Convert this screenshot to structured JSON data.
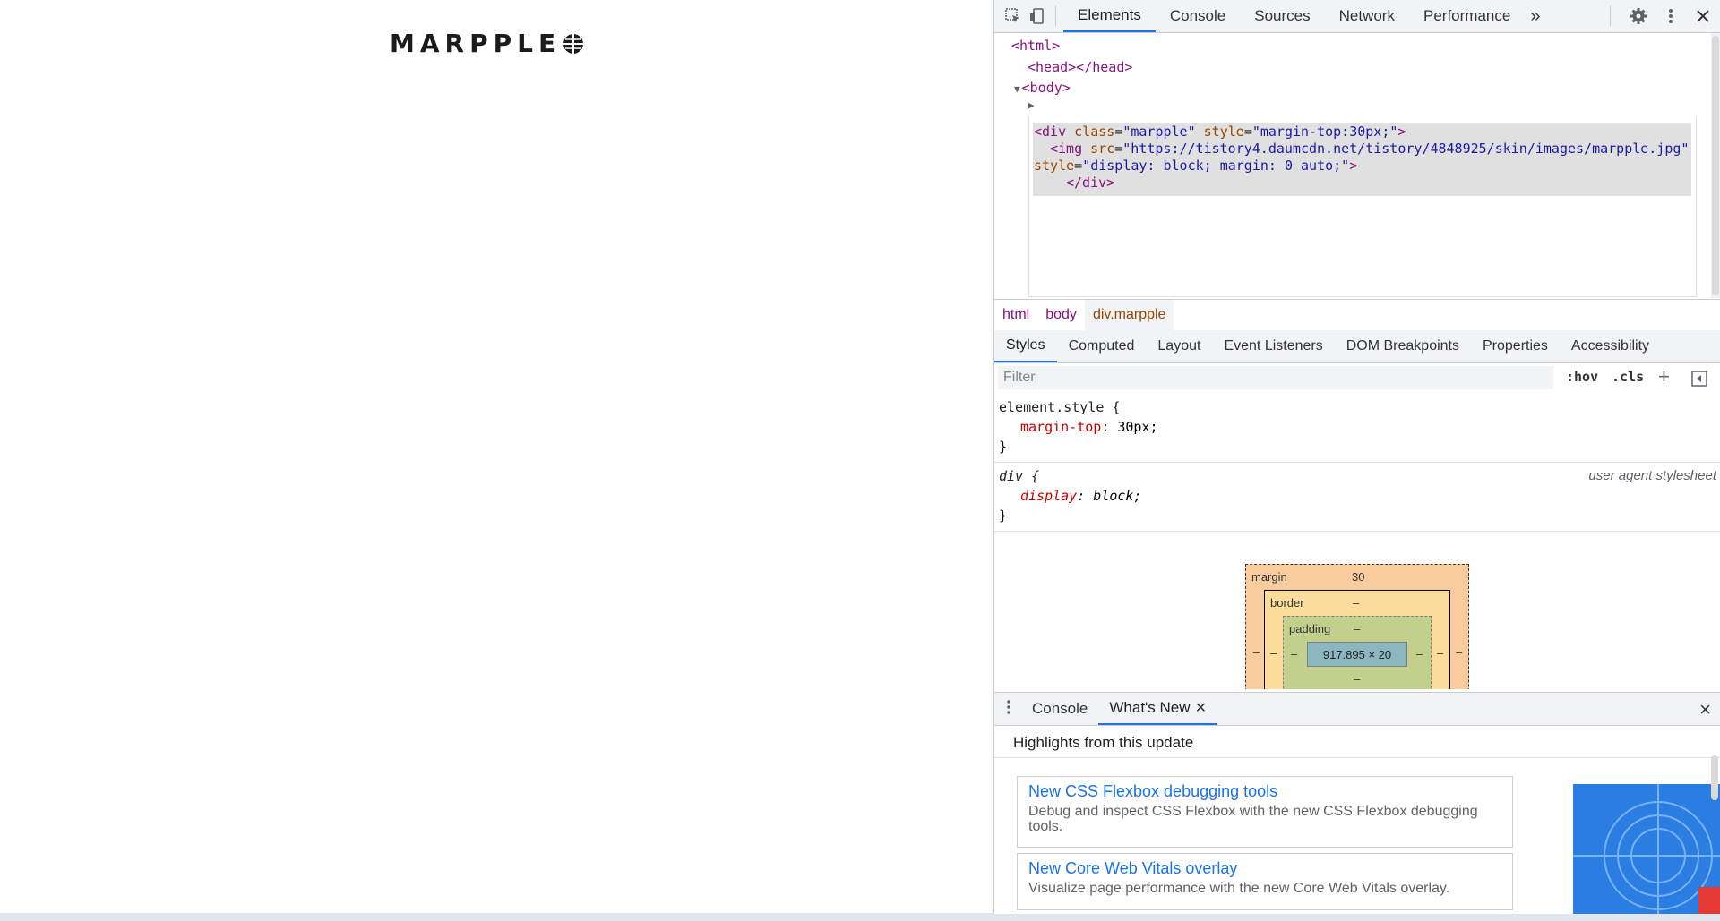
{
  "page": {
    "logo_text": "MARPPLE"
  },
  "devtools": {
    "main_tabs": [
      "Elements",
      "Console",
      "Sources",
      "Network",
      "Performance"
    ],
    "more_tabs_glyph": "»",
    "dom": {
      "html_open": "<html>",
      "head": "<head></head>",
      "body_open": "<body>",
      "div_tag_open": "<div",
      "div_class_attr": "class",
      "div_class_val": "\"marpple\"",
      "div_style_attr": "style",
      "div_style_val": "\"margin-top:30px;\"",
      "div_close_bracket": ">",
      "img_tag_open": "<img",
      "img_src_attr": "src",
      "img_src_val": "\"https://tistory4.daumcdn.net/tistory/4848925/skin/images/marpple.jpg\"",
      "img_style_attr": "style",
      "img_style_val": "\"display: block; margin: 0 auto;\"",
      "img_close_bracket": ">",
      "div_close": "</div>"
    },
    "breadcrumbs": [
      "html",
      "body",
      "div.marpple"
    ],
    "sub_tabs": [
      "Styles",
      "Computed",
      "Layout",
      "Event Listeners",
      "DOM Breakpoints",
      "Properties",
      "Accessibility"
    ],
    "filter": {
      "placeholder": "Filter",
      "hov": ":hov",
      "cls": ".cls",
      "add": "+"
    },
    "rules": [
      {
        "selector": "element.style {",
        "prop": "margin-top",
        "value": "30px;",
        "close": "}",
        "source": ""
      },
      {
        "selector": "div {",
        "prop": "display",
        "value": "block;",
        "close": "}",
        "source": "user agent stylesheet"
      }
    ],
    "box_model": {
      "margin_label": "margin",
      "margin_top": "30",
      "border_label": "border",
      "border_top": "–",
      "padding_label": "padding",
      "padding_top": "–",
      "content": "917.895 × 20",
      "dash": "–"
    },
    "drawer": {
      "tabs": [
        "Console",
        "What's New"
      ],
      "close_glyph": "×",
      "highlights": "Highlights from this update",
      "news": [
        {
          "title": "New CSS Flexbox debugging tools",
          "desc": "Debug and inspect CSS Flexbox with the new CSS Flexbox debugging tools."
        },
        {
          "title": "New Core Web Vitals overlay",
          "desc": "Visualize page performance with the new Core Web Vitals overlay."
        }
      ]
    }
  },
  "colors": {
    "accent": "#1a73e8",
    "tag": "#881280",
    "attr": "#994500",
    "value": "#1a1aa6",
    "prop": "#c80000"
  }
}
